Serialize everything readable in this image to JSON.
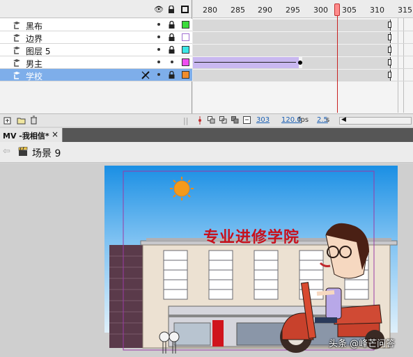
{
  "timeline": {
    "frame_numbers": [
      "280",
      "285",
      "290",
      "295",
      "300",
      "305",
      "310",
      "315"
    ],
    "header_icons": [
      "eye-icon",
      "lock-icon",
      "outline-icon"
    ],
    "layers": [
      {
        "name": "黑布",
        "color": "#3cdc3c",
        "selected": false
      },
      {
        "name": "边界",
        "color": "#c89cf0",
        "selected": false
      },
      {
        "name": "图层 5",
        "color": "#3ce6e6",
        "selected": false
      },
      {
        "name": "男主",
        "color": "#f04cf0",
        "selected": false
      },
      {
        "name": "学校",
        "color": "#f08c2c",
        "selected": true
      }
    ],
    "current_frame": "303",
    "frame_rate": "120.0",
    "frame_rate_unit": "fps",
    "elapsed": "2.5",
    "elapsed_unit": "s"
  },
  "document": {
    "tab_label": "MV -我相信*",
    "tab_close": "×",
    "scene_label": "场景 9"
  },
  "stage": {
    "banner_text": "专业进修学院",
    "watermark": "头条 @峰芒问答"
  }
}
